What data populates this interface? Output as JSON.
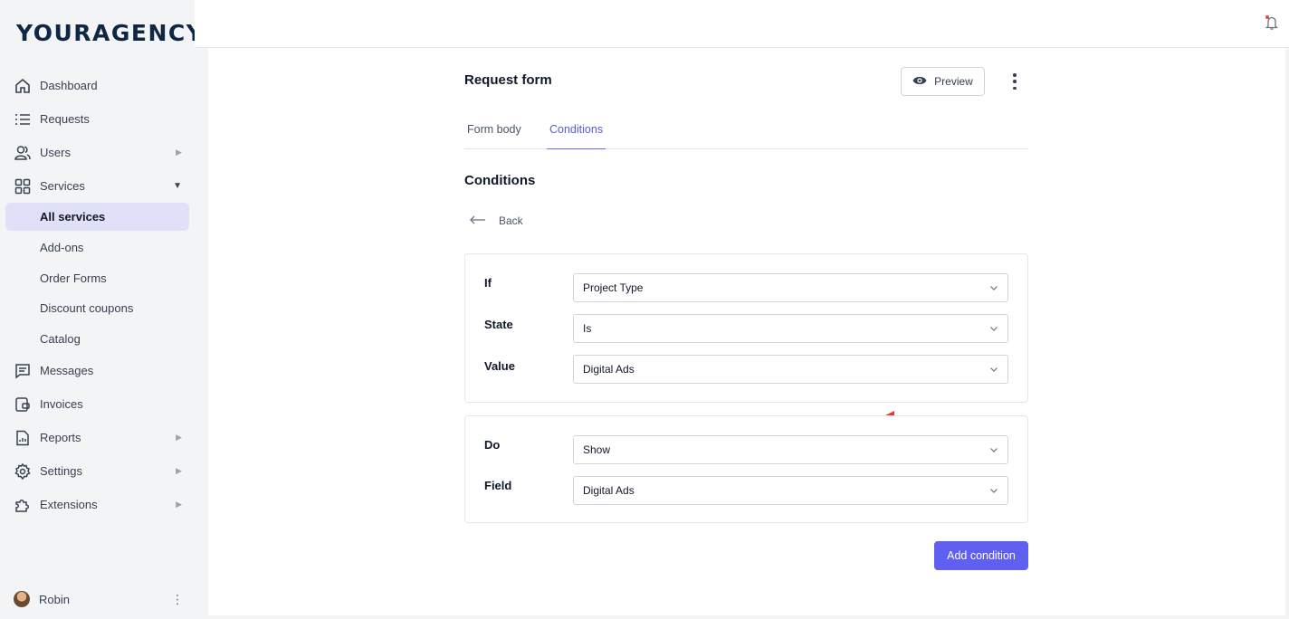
{
  "brand": {
    "logo": "YOURAGENCY"
  },
  "sidebar": {
    "items": [
      {
        "label": "Dashboard",
        "icon": "home-icon"
      },
      {
        "label": "Requests",
        "icon": "list-icon"
      },
      {
        "label": "Users",
        "icon": "users-icon",
        "caret": "▶"
      },
      {
        "label": "Services",
        "icon": "grid-icon",
        "caret": "▼"
      }
    ],
    "services_sub": [
      "All services",
      "Add-ons",
      "Order Forms",
      "Discount coupons",
      "Catalog"
    ],
    "items_after": [
      {
        "label": "Messages",
        "icon": "chat-icon"
      },
      {
        "label": "Invoices",
        "icon": "wallet-icon"
      },
      {
        "label": "Reports",
        "icon": "report-icon",
        "caret": "▶"
      },
      {
        "label": "Settings",
        "icon": "gear-icon",
        "caret": "▶"
      },
      {
        "label": "Extensions",
        "icon": "puzzle-icon",
        "caret": "▶"
      }
    ],
    "user": {
      "name": "Robin",
      "more": "⋮"
    }
  },
  "header": {
    "notification_icon": "bell-icon",
    "notification_dot_color": "#ef4444"
  },
  "page": {
    "title": "Request form",
    "preview_label": "Preview",
    "tabs": [
      "Form body",
      "Conditions"
    ],
    "active_tab": "Conditions",
    "section_title": "Conditions",
    "back_label": "Back"
  },
  "condition_if": {
    "if_label": "If",
    "if_value": "Project Type",
    "state_label": "State",
    "state_value": "Is",
    "value_label": "Value",
    "value_value": "Digital Ads"
  },
  "condition_do": {
    "do_label": "Do",
    "do_value": "Show",
    "field_label": "Field",
    "field_value": "Digital Ads"
  },
  "actions": {
    "add_condition_label": "Add condition"
  },
  "colors": {
    "accent": "#5f5ff0",
    "active_tab": "#5b5bd6",
    "annotation_arrow": "#e53935",
    "active_nav_bg": "#e0e0f8"
  }
}
